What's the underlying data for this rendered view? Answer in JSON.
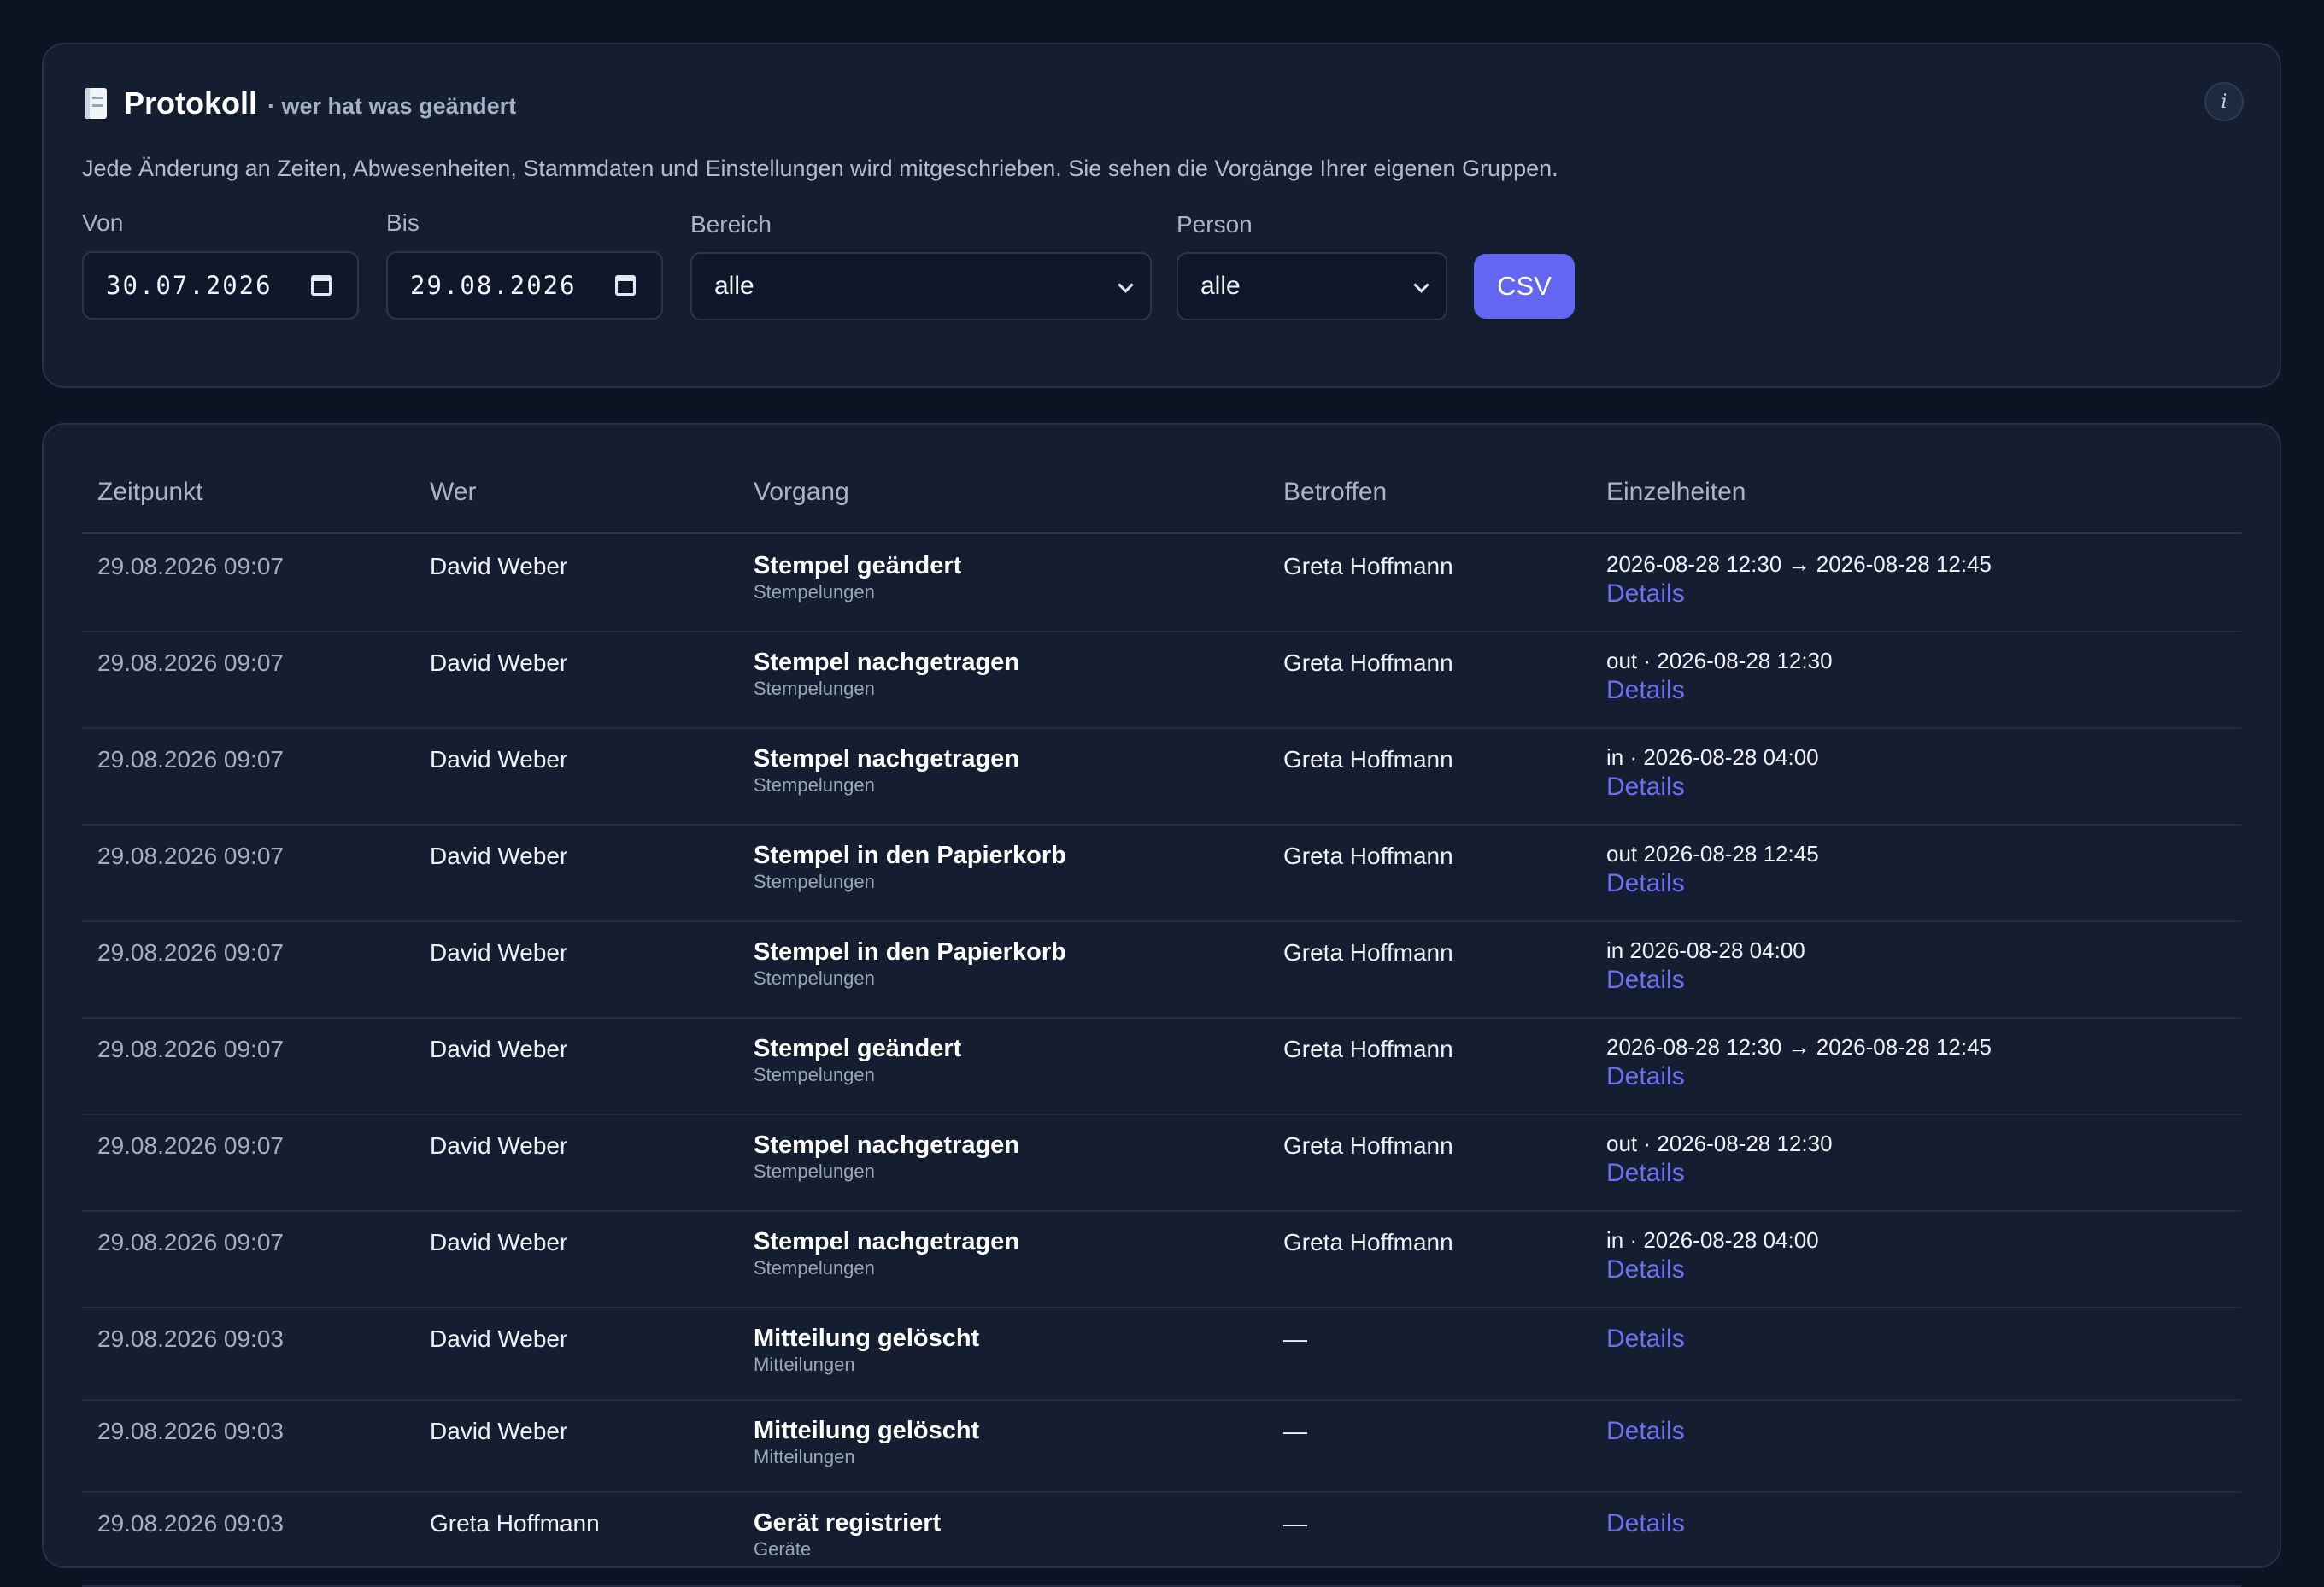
{
  "header": {
    "title": "Protokoll",
    "subtitle": "· wer hat was geändert",
    "description": "Jede Änderung an Zeiten, Abwesenheiten, Stammdaten und Einstellungen wird mitgeschrieben. Sie sehen die Vorgänge Ihrer eigenen Gruppen.",
    "info_label": "i"
  },
  "filters": {
    "von_label": "Von",
    "von_value": "30.07.2026",
    "bis_label": "Bis",
    "bis_value": "29.08.2026",
    "bereich_label": "Bereich",
    "bereich_value": "alle",
    "person_label": "Person",
    "person_value": "alle",
    "csv_label": "CSV"
  },
  "table": {
    "columns": [
      "Zeitpunkt",
      "Wer",
      "Vorgang",
      "Betroffen",
      "Einzelheiten"
    ],
    "rows": [
      {
        "time": "29.08.2026 09:07",
        "who": "David Weber",
        "op": "Stempel geändert",
        "cat": "Stempelungen",
        "affected": "Greta Hoffmann",
        "detail": "2026-08-28 12:30 → 2026-08-28 12:45",
        "link": "Details"
      },
      {
        "time": "29.08.2026 09:07",
        "who": "David Weber",
        "op": "Stempel nachgetragen",
        "cat": "Stempelungen",
        "affected": "Greta Hoffmann",
        "detail": "out · 2026-08-28 12:30",
        "link": "Details"
      },
      {
        "time": "29.08.2026 09:07",
        "who": "David Weber",
        "op": "Stempel nachgetragen",
        "cat": "Stempelungen",
        "affected": "Greta Hoffmann",
        "detail": "in · 2026-08-28 04:00",
        "link": "Details"
      },
      {
        "time": "29.08.2026 09:07",
        "who": "David Weber",
        "op": "Stempel in den Papierkorb",
        "cat": "Stempelungen",
        "affected": "Greta Hoffmann",
        "detail": "out 2026-08-28 12:45",
        "link": "Details"
      },
      {
        "time": "29.08.2026 09:07",
        "who": "David Weber",
        "op": "Stempel in den Papierkorb",
        "cat": "Stempelungen",
        "affected": "Greta Hoffmann",
        "detail": "in 2026-08-28 04:00",
        "link": "Details"
      },
      {
        "time": "29.08.2026 09:07",
        "who": "David Weber",
        "op": "Stempel geändert",
        "cat": "Stempelungen",
        "affected": "Greta Hoffmann",
        "detail": "2026-08-28 12:30 → 2026-08-28 12:45",
        "link": "Details"
      },
      {
        "time": "29.08.2026 09:07",
        "who": "David Weber",
        "op": "Stempel nachgetragen",
        "cat": "Stempelungen",
        "affected": "Greta Hoffmann",
        "detail": "out · 2026-08-28 12:30",
        "link": "Details"
      },
      {
        "time": "29.08.2026 09:07",
        "who": "David Weber",
        "op": "Stempel nachgetragen",
        "cat": "Stempelungen",
        "affected": "Greta Hoffmann",
        "detail": "in · 2026-08-28 04:00",
        "link": "Details"
      },
      {
        "time": "29.08.2026 09:03",
        "who": "David Weber",
        "op": "Mitteilung gelöscht",
        "cat": "Mitteilungen",
        "affected": "—",
        "detail": "",
        "link": "Details"
      },
      {
        "time": "29.08.2026 09:03",
        "who": "David Weber",
        "op": "Mitteilung gelöscht",
        "cat": "Mitteilungen",
        "affected": "—",
        "detail": "",
        "link": "Details"
      },
      {
        "time": "29.08.2026 09:03",
        "who": "Greta Hoffmann",
        "op": "Gerät registriert",
        "cat": "Geräte",
        "affected": "—",
        "detail": "",
        "link": "Details"
      }
    ]
  }
}
